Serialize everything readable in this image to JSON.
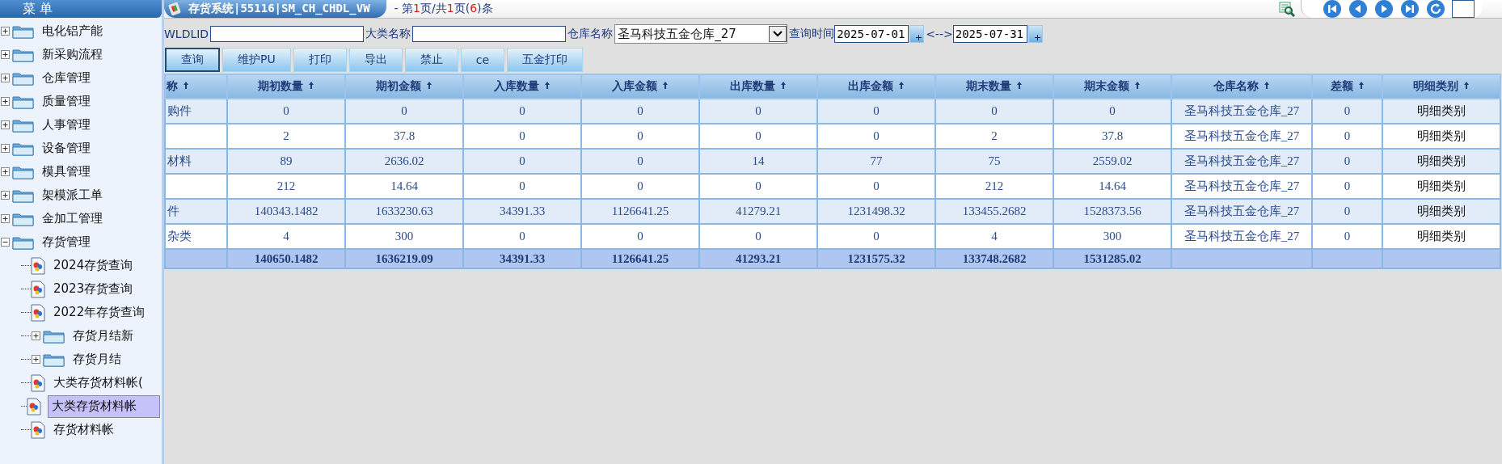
{
  "sidebar": {
    "title": "菜 单",
    "items": [
      {
        "label": "电化铝产能",
        "kind": "folder",
        "expanded": false,
        "selected": false
      },
      {
        "label": "新采购流程",
        "kind": "folder",
        "expanded": false,
        "selected": false
      },
      {
        "label": "仓库管理",
        "kind": "folder",
        "expanded": false,
        "selected": false
      },
      {
        "label": "质量管理",
        "kind": "folder",
        "expanded": false,
        "selected": false
      },
      {
        "label": "人事管理",
        "kind": "folder",
        "expanded": false,
        "selected": false
      },
      {
        "label": "设备管理",
        "kind": "folder",
        "expanded": false,
        "selected": false
      },
      {
        "label": "模具管理",
        "kind": "folder",
        "expanded": false,
        "selected": false
      },
      {
        "label": "架模派工单",
        "kind": "folder",
        "expanded": false,
        "selected": false
      },
      {
        "label": "金加工管理",
        "kind": "folder",
        "expanded": false,
        "selected": false
      },
      {
        "label": "存货管理",
        "kind": "folder",
        "expanded": true,
        "selected": false,
        "children": [
          {
            "label": "2024存货查询",
            "kind": "page",
            "selected": false
          },
          {
            "label": "2023存货查询",
            "kind": "page",
            "selected": false
          },
          {
            "label": "2022年存货查询",
            "kind": "page",
            "selected": false
          },
          {
            "label": "存货月结新",
            "kind": "folder",
            "expanded": false,
            "selected": false
          },
          {
            "label": "存货月结",
            "kind": "folder",
            "expanded": false,
            "selected": false
          },
          {
            "label": "大类存货材料帐(",
            "kind": "page",
            "selected": false
          },
          {
            "label": "大类存货材料帐",
            "kind": "page",
            "selected": true
          },
          {
            "label": "存货材料帐",
            "kind": "page",
            "selected": false
          }
        ]
      }
    ]
  },
  "title_tab": "存货系统|55116|SM_CH_CHDL_VW",
  "pager": [
    {
      "text": "- 第",
      "kind": "plain"
    },
    {
      "text": "1",
      "kind": "number"
    },
    {
      "text": "页/共",
      "kind": "plain"
    },
    {
      "text": "1",
      "kind": "number"
    },
    {
      "text": "页(",
      "kind": "plain"
    },
    {
      "text": "6",
      "kind": "number"
    },
    {
      "text": ")条",
      "kind": "plain"
    }
  ],
  "filters": [
    {
      "label": "WLDLID",
      "kind": "text"
    },
    {
      "label": "大类名称",
      "kind": "text"
    },
    {
      "label": "仓库名称",
      "kind": "select",
      "value": "圣马科技五金仓库_27"
    },
    {
      "label": "查询时间",
      "kind": "date",
      "value": "2025-07-01"
    },
    {
      "label": "<-->",
      "kind": "date",
      "value": "2025-07-31"
    }
  ],
  "buttons": [
    "查询",
    "维护PU",
    "打印",
    "导出",
    "禁止",
    "ce",
    "五金打印"
  ],
  "table": {
    "columns": [
      "称",
      "期初数量",
      "期初金额",
      "入库数量",
      "入库金额",
      "出库数量",
      "出库金额",
      "期末数量",
      "期末金额",
      "仓库名称",
      "差额",
      "明细类别"
    ],
    "rows": [
      [
        "购件",
        "0",
        "0",
        "0",
        "0",
        "0",
        "0",
        "0",
        "0",
        "圣马科技五金仓库_27",
        "0",
        "明细类别"
      ],
      [
        null,
        "2",
        "37.8",
        "0",
        "0",
        "0",
        "0",
        "2",
        "37.8",
        "圣马科技五金仓库_27",
        "0",
        "明细类别"
      ],
      [
        "材料",
        "89",
        "2636.02",
        "0",
        "0",
        "14",
        "77",
        "75",
        "2559.02",
        "圣马科技五金仓库_27",
        "0",
        "明细类别"
      ],
      [
        null,
        "212",
        "14.64",
        "0",
        "0",
        "0",
        "0",
        "212",
        "14.64",
        "圣马科技五金仓库_27",
        "0",
        "明细类别"
      ],
      [
        "件",
        "140343.1482",
        "1633230.63",
        "34391.33",
        "1126641.25",
        "41279.21",
        "1231498.32",
        "133455.2682",
        "1528373.56",
        "圣马科技五金仓库_27",
        "0",
        "明细类别"
      ],
      [
        "杂类",
        "4",
        "300",
        "0",
        "0",
        "0",
        "0",
        "4",
        "300",
        "圣马科技五金仓库_27",
        "0",
        "明细类别"
      ]
    ],
    "totals": [
      "140650.1482",
      "1636219.09",
      "34391.33",
      "1126641.25",
      "41293.21",
      "1231575.32",
      "133748.2682",
      "1531285.02"
    ]
  }
}
